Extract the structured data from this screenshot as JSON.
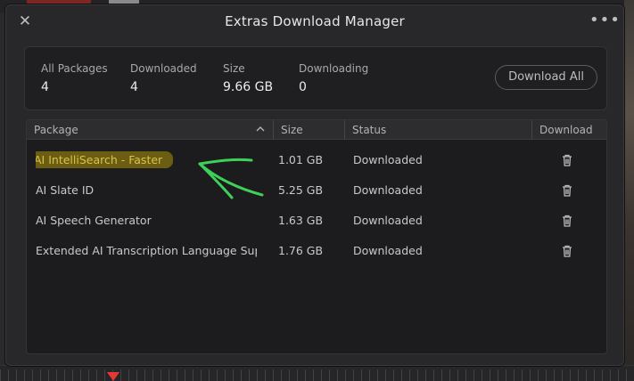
{
  "dialog": {
    "title": "Extras Download Manager",
    "close_icon": "close-icon",
    "more_icon": "more-horizontal-icon"
  },
  "summary": {
    "all_packages_label": "All Packages",
    "all_packages_value": "4",
    "downloaded_label": "Downloaded",
    "downloaded_value": "4",
    "size_label": "Size",
    "size_value": "9.66 GB",
    "downloading_label": "Downloading",
    "downloading_value": "0",
    "download_all_label": "Download All"
  },
  "table": {
    "headers": {
      "package": "Package",
      "size": "Size",
      "status": "Status",
      "download": "Download"
    },
    "rows": [
      {
        "name": "AI IntelliSearch - Faster",
        "size": "1.01 GB",
        "status": "Downloaded",
        "icon": "trash-icon"
      },
      {
        "name": "AI Slate ID",
        "size": "5.25 GB",
        "status": "Downloaded",
        "icon": "trash-icon"
      },
      {
        "name": "AI Speech Generator",
        "size": "1.63 GB",
        "status": "Downloaded",
        "icon": "trash-icon"
      },
      {
        "name": "Extended AI Transcription Language Supp...",
        "size": "1.76 GB",
        "status": "Downloaded",
        "icon": "trash-icon"
      }
    ]
  },
  "colors": {
    "highlight": "#6b5d12",
    "annotation_arrow": "#3fd05a",
    "playhead": "#e53935"
  }
}
